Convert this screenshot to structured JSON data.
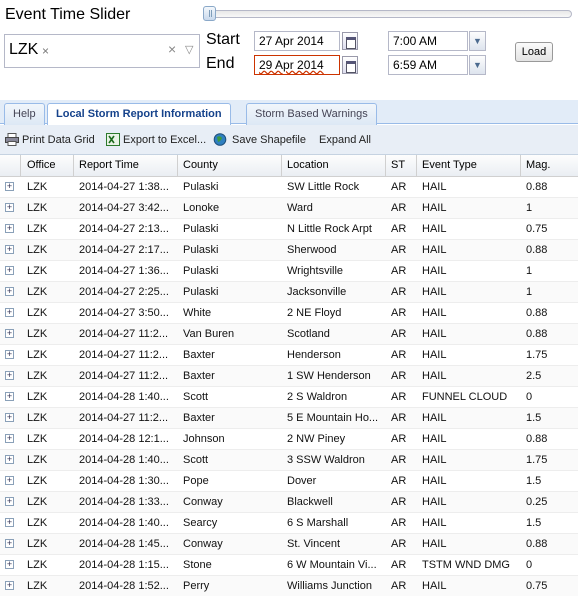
{
  "header": {
    "title": "Event Time Slider"
  },
  "office_filter": {
    "tag": "LZK",
    "tag_remove": "×",
    "clear": "×",
    "expand": "▽"
  },
  "start": {
    "label": "Start",
    "date": "27 Apr 2014",
    "time": "7:00 AM"
  },
  "end": {
    "label": "End",
    "date": "29 Apr 2014",
    "time": "6:59 AM"
  },
  "load_label": "Load",
  "tabs": [
    {
      "label": "Help",
      "active": false
    },
    {
      "label": "Local Storm Report Information",
      "active": true
    },
    {
      "label": "Storm Based Warnings",
      "active": false
    }
  ],
  "toolbar": {
    "print": "Print Data Grid",
    "export": "Export to Excel...",
    "shapefile": "Save Shapefile",
    "expand": "Expand All"
  },
  "columns": [
    "Office",
    "Report Time",
    "County",
    "Location",
    "ST",
    "Event Type",
    "Mag."
  ],
  "rows": [
    [
      "LZK",
      "2014-04-27 1:38...",
      "Pulaski",
      "SW Little Rock",
      "AR",
      "HAIL",
      "0.88"
    ],
    [
      "LZK",
      "2014-04-27 3:42...",
      "Lonoke",
      "Ward",
      "AR",
      "HAIL",
      "1"
    ],
    [
      "LZK",
      "2014-04-27 2:13...",
      "Pulaski",
      "N Little Rock Arpt",
      "AR",
      "HAIL",
      "0.75"
    ],
    [
      "LZK",
      "2014-04-27 2:17...",
      "Pulaski",
      "Sherwood",
      "AR",
      "HAIL",
      "0.88"
    ],
    [
      "LZK",
      "2014-04-27 1:36...",
      "Pulaski",
      "Wrightsville",
      "AR",
      "HAIL",
      "1"
    ],
    [
      "LZK",
      "2014-04-27 2:25...",
      "Pulaski",
      "Jacksonville",
      "AR",
      "HAIL",
      "1"
    ],
    [
      "LZK",
      "2014-04-27 3:50...",
      "White",
      "2 NE Floyd",
      "AR",
      "HAIL",
      "0.88"
    ],
    [
      "LZK",
      "2014-04-27 11:2...",
      "Van Buren",
      "Scotland",
      "AR",
      "HAIL",
      "0.88"
    ],
    [
      "LZK",
      "2014-04-27 11:2...",
      "Baxter",
      "Henderson",
      "AR",
      "HAIL",
      "1.75"
    ],
    [
      "LZK",
      "2014-04-27 11:2...",
      "Baxter",
      "1 SW Henderson",
      "AR",
      "HAIL",
      "2.5"
    ],
    [
      "LZK",
      "2014-04-28 1:40...",
      "Scott",
      "2 S Waldron",
      "AR",
      "FUNNEL CLOUD",
      "0"
    ],
    [
      "LZK",
      "2014-04-27 11:2...",
      "Baxter",
      "5 E Mountain Ho...",
      "AR",
      "HAIL",
      "1.5"
    ],
    [
      "LZK",
      "2014-04-28 12:1...",
      "Johnson",
      "2 NW Piney",
      "AR",
      "HAIL",
      "0.88"
    ],
    [
      "LZK",
      "2014-04-28 1:40...",
      "Scott",
      "3 SSW Waldron",
      "AR",
      "HAIL",
      "1.75"
    ],
    [
      "LZK",
      "2014-04-28 1:30...",
      "Pope",
      "Dover",
      "AR",
      "HAIL",
      "1.5"
    ],
    [
      "LZK",
      "2014-04-28 1:33...",
      "Conway",
      "Blackwell",
      "AR",
      "HAIL",
      "0.25"
    ],
    [
      "LZK",
      "2014-04-28 1:40...",
      "Searcy",
      "6 S Marshall",
      "AR",
      "HAIL",
      "1.5"
    ],
    [
      "LZK",
      "2014-04-28 1:45...",
      "Conway",
      "St. Vincent",
      "AR",
      "HAIL",
      "0.88"
    ],
    [
      "LZK",
      "2014-04-28 1:15...",
      "Stone",
      "6 W Mountain Vi...",
      "AR",
      "TSTM WND DMG",
      "0"
    ],
    [
      "LZK",
      "2014-04-28 1:52...",
      "Perry",
      "Williams Junction",
      "AR",
      "HAIL",
      "0.75"
    ]
  ],
  "expander_glyph": "+"
}
